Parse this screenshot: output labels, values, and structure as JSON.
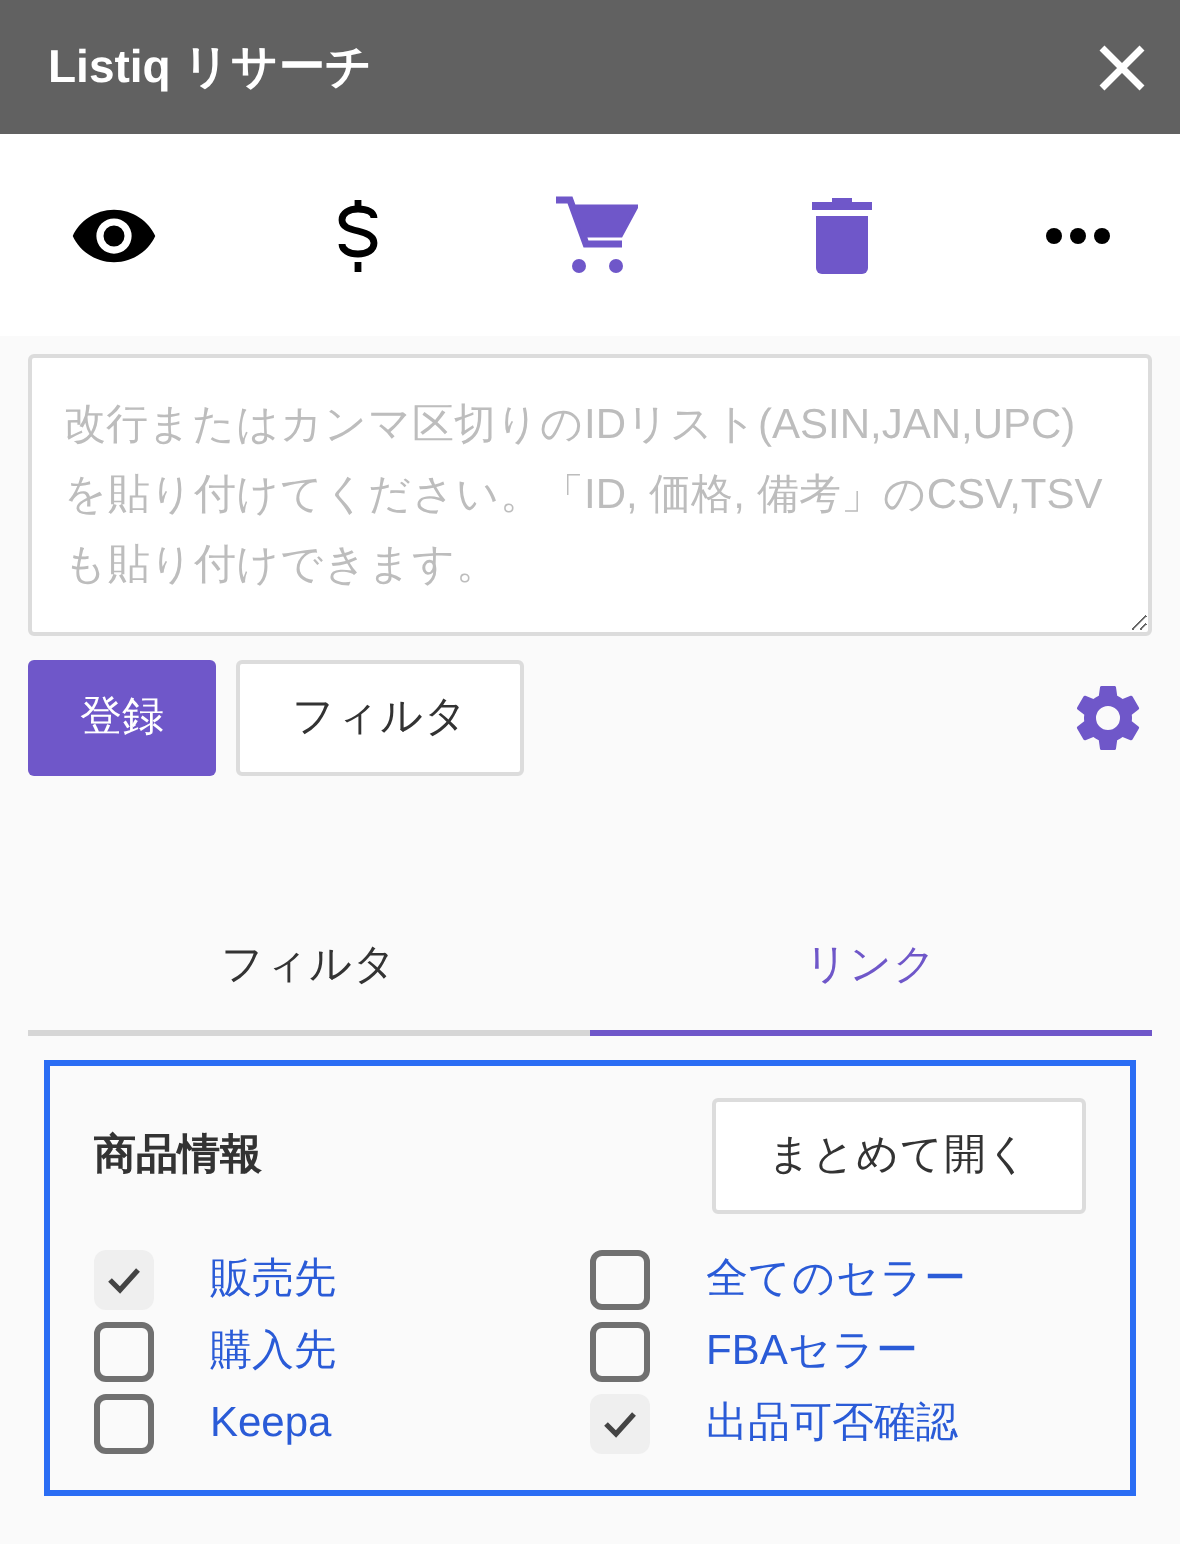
{
  "window": {
    "title": "Listiq リサーチ"
  },
  "toolbar": [
    {
      "kind": "eye",
      "active": false
    },
    {
      "kind": "dollar",
      "active": false
    },
    {
      "kind": "cart",
      "active": true
    },
    {
      "kind": "trash",
      "active": true
    },
    {
      "kind": "more",
      "active": false
    }
  ],
  "id_input": {
    "placeholder": "改行またはカンマ区切りのIDリスト(ASIN,JAN,UPC)を貼り付けてください。「ID, 価格, 備考」のCSV,TSVも貼り付けできます。"
  },
  "buttons": [
    {
      "label": "登録",
      "kind": "primary"
    },
    {
      "label": "フィルタ",
      "kind": "secondary"
    }
  ],
  "tabs": [
    {
      "label": "フィルタ",
      "selected": false
    },
    {
      "label": "リンク",
      "selected": true
    }
  ],
  "section": {
    "title": "商品情報",
    "open_all_button": "まとめて開く",
    "links": [
      {
        "label": "販売先",
        "checked": true
      },
      {
        "label": "全てのセラー",
        "checked": false
      },
      {
        "label": "購入先",
        "checked": false
      },
      {
        "label": "FBAセラー",
        "checked": false
      },
      {
        "label": "Keepa",
        "checked": false
      },
      {
        "label": "出品可否確認",
        "checked": true
      }
    ]
  }
}
